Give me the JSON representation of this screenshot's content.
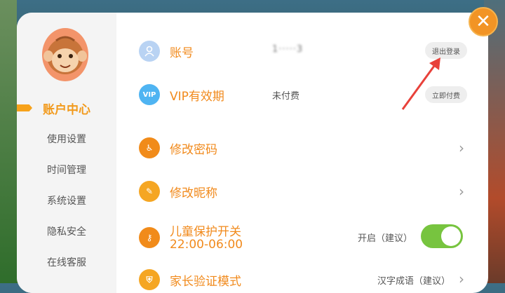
{
  "sidebar": {
    "items": [
      {
        "label": "账户中心"
      },
      {
        "label": "使用设置"
      },
      {
        "label": "时间管理"
      },
      {
        "label": "系统设置"
      },
      {
        "label": "隐私安全"
      },
      {
        "label": "在线客服"
      }
    ]
  },
  "account": {
    "label": "账号",
    "value": "1·····3",
    "logout_label": "退出登录"
  },
  "vip": {
    "icon_text": "VIP",
    "label": "VIP有效期",
    "status": "未付费",
    "pay_label": "立即付费"
  },
  "change_password": {
    "label": "修改密码"
  },
  "change_nickname": {
    "label": "修改昵称"
  },
  "child_protection": {
    "label": "儿童保护开关",
    "time_range": "22:00-06:00",
    "status_text": "开启（建议）",
    "enabled": true
  },
  "parent_verify": {
    "label": "家长验证模式",
    "value": "汉字成语（建议）"
  },
  "colors": {
    "accent_orange": "#f18a1c",
    "toggle_green": "#77c43f",
    "annotation_red": "#e8413a"
  }
}
